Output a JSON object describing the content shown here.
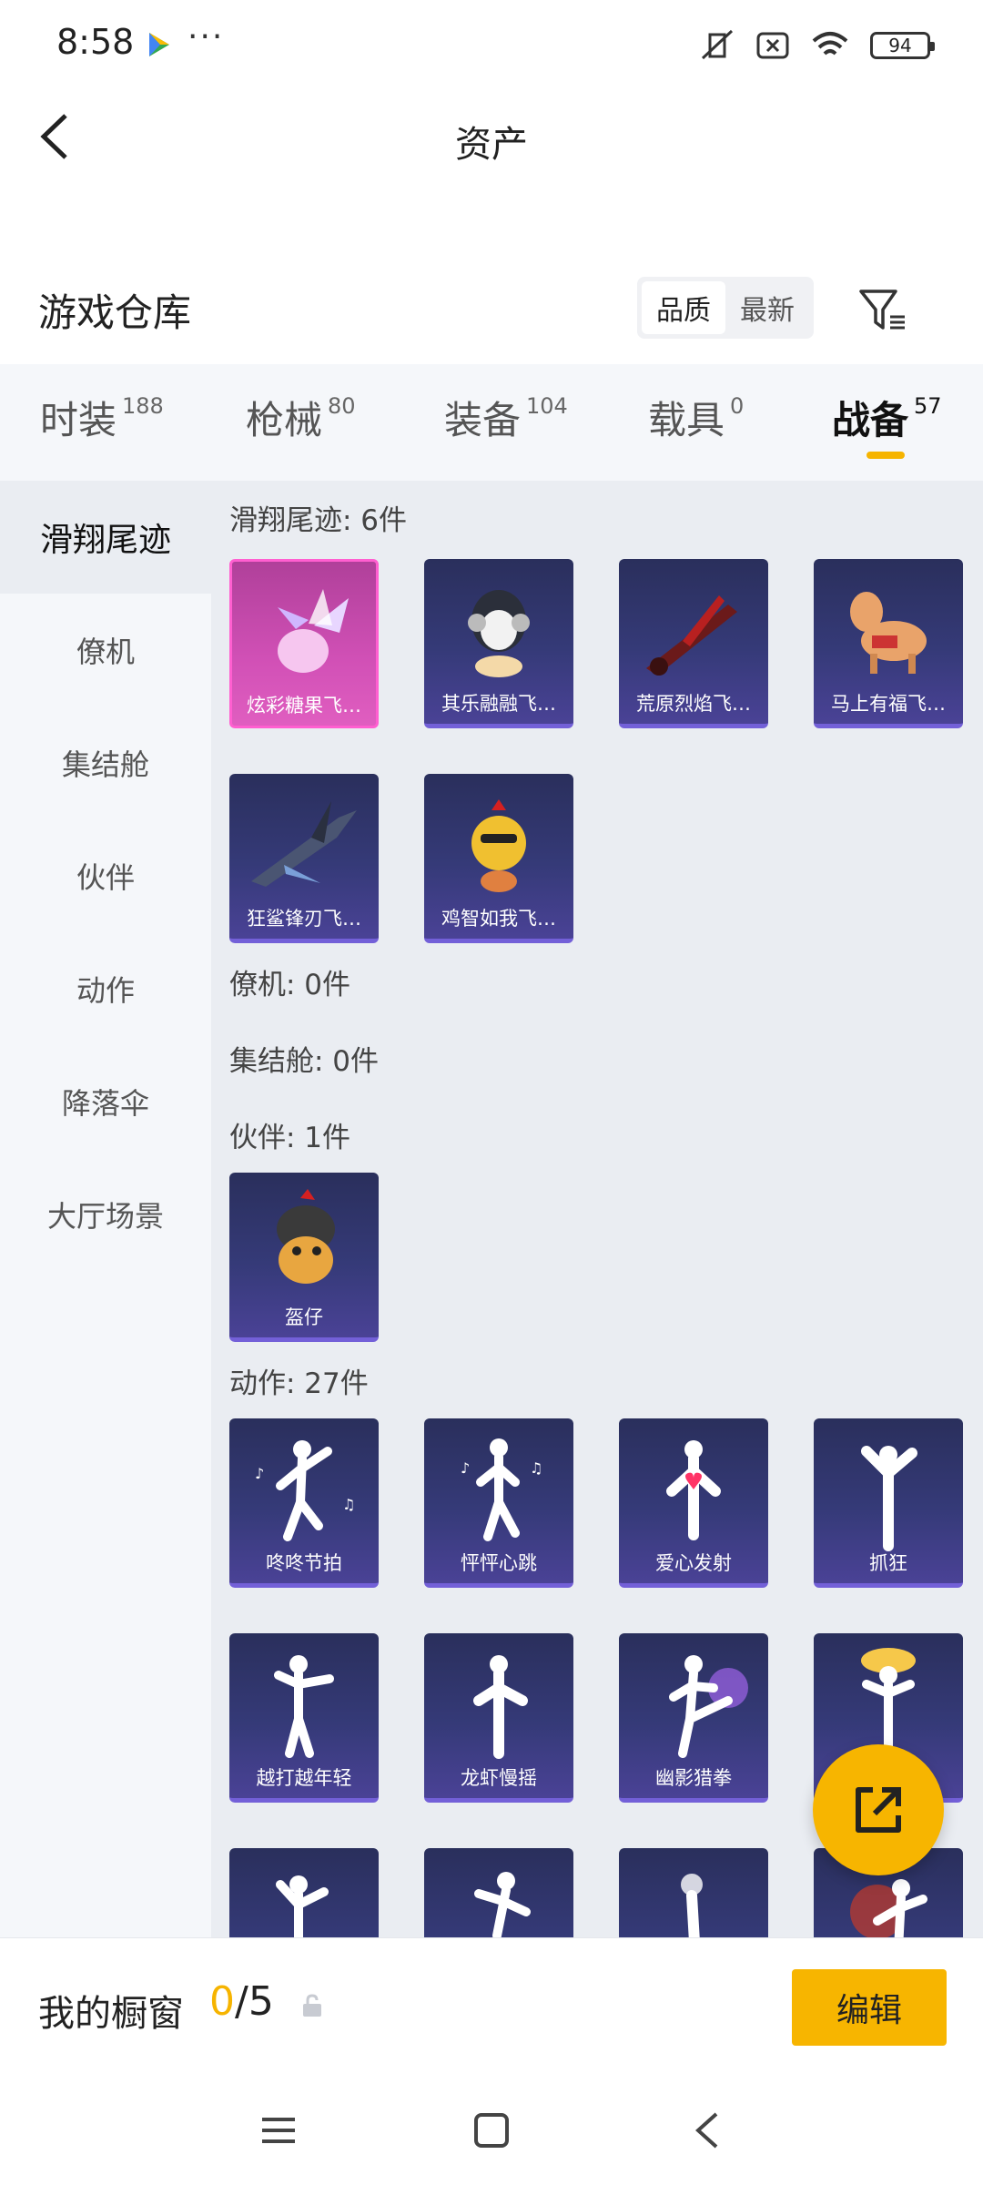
{
  "status_bar": {
    "time": "8:58",
    "more": "···",
    "battery": "94"
  },
  "header": {
    "title": "资产"
  },
  "warehouse": {
    "title": "游戏仓库",
    "sort_options": [
      "品质",
      "最新"
    ],
    "active_sort": "品质"
  },
  "tabs": [
    {
      "label": "时装",
      "count": "188"
    },
    {
      "label": "枪械",
      "count": "80"
    },
    {
      "label": "装备",
      "count": "104"
    },
    {
      "label": "载具",
      "count": "0"
    },
    {
      "label": "战备",
      "count": "57",
      "active": true
    }
  ],
  "sidebar": {
    "items": [
      "滑翔尾迹",
      "僚机",
      "集结舱",
      "伙伴",
      "动作",
      "降落伞",
      "大厅场景"
    ],
    "active": "滑翔尾迹"
  },
  "sections": [
    {
      "title": "滑翔尾迹: 6件",
      "items": [
        "炫彩糖果飞…",
        "其乐融融飞…",
        "荒原烈焰飞…",
        "马上有福飞…",
        "狂鲨锋刃飞…",
        "鸡智如我飞…"
      ]
    },
    {
      "title": "僚机: 0件",
      "items": []
    },
    {
      "title": "集结舱: 0件",
      "items": []
    },
    {
      "title": "伙伴: 1件",
      "items": [
        "盔仔"
      ]
    },
    {
      "title": "动作: 27件",
      "items": [
        "咚咚节拍",
        "怦怦心跳",
        "爱心发射",
        "抓狂",
        "越打越年轻",
        "龙虾慢摇",
        "幽影猎拳",
        "",
        "",
        "",
        "",
        ""
      ]
    }
  ],
  "bottom": {
    "showcase_title": "我的橱窗",
    "current": "0",
    "total": "/5",
    "edit_label": "编辑"
  },
  "colors": {
    "accent": "#f7b500",
    "card_bg": "#353a78",
    "card_pink": "#d150b6"
  }
}
